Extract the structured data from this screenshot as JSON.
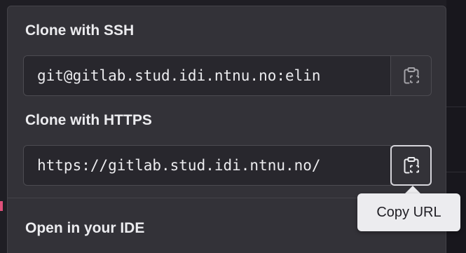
{
  "clone_ssh": {
    "title": "Clone with SSH",
    "url": "git@gitlab.stud.idi.ntnu.no:elin",
    "copy_icon": "clipboard-icon"
  },
  "clone_https": {
    "title": "Clone with HTTPS",
    "url": "https://gitlab.stud.idi.ntnu.no/",
    "copy_icon": "clipboard-icon"
  },
  "open_ide": {
    "title": "Open in your IDE"
  },
  "tooltip": {
    "text": "Copy URL"
  },
  "colors": {
    "panel": "#333238",
    "input_bg": "#28272d",
    "text": "#ececef",
    "tooltip_bg": "#ececef"
  }
}
